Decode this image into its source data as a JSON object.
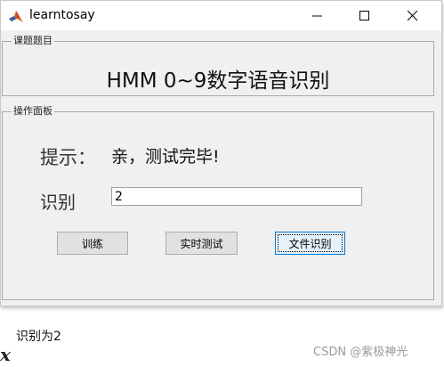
{
  "window": {
    "title": "learntosay",
    "icon": "matlab-icon",
    "controls": [
      "minimize-icon",
      "maximize-icon",
      "close-icon"
    ]
  },
  "group_title": {
    "label": "课题题目",
    "heading": "HMM 0~9数字语音识别"
  },
  "group_ops": {
    "label": "操作面板",
    "hint_label": "提示：",
    "hint_value": "亲，测试完毕!",
    "rec_label": "识别",
    "rec_value": "2"
  },
  "buttons": {
    "train": "训练",
    "realtime": "实时测试",
    "file": "文件识别"
  },
  "background": {
    "left_glyph": "x",
    "output": "识别为2",
    "watermark": "CSDN @紫极神光"
  },
  "colors": {
    "focus_border": "#0078d7",
    "window_bg": "#f0f0f0"
  }
}
